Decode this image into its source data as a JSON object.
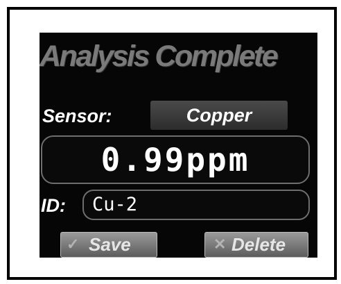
{
  "screen": {
    "title": "Analysis Complete",
    "sensor": {
      "label": "Sensor:",
      "value": "Copper"
    },
    "reading": {
      "value": "0.99ppm"
    },
    "id": {
      "label": "ID:",
      "value": "Cu-2"
    },
    "buttons": {
      "save": {
        "label": "Save",
        "icon": "check-icon"
      },
      "delete": {
        "label": "Delete",
        "icon": "cross-icon"
      }
    }
  },
  "colors": {
    "background": "#060606",
    "title": "#7a7a7a",
    "text": "#ffffff",
    "button": "#7c7c7c"
  }
}
